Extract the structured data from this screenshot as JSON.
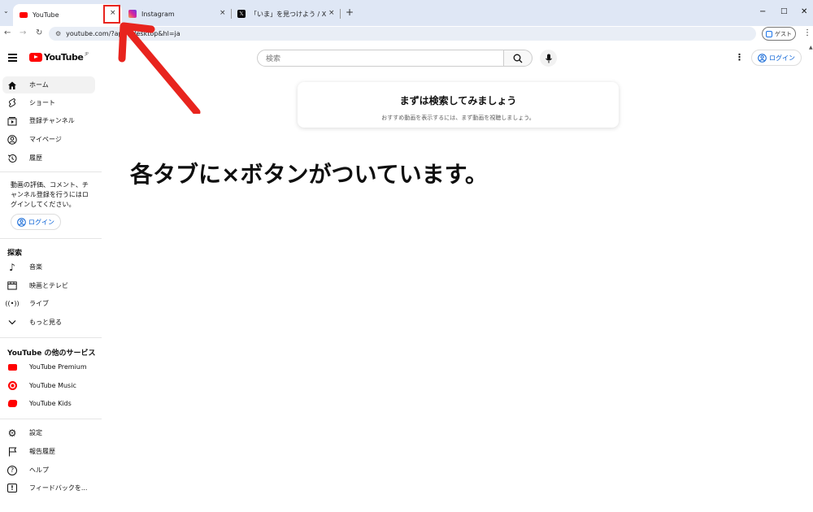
{
  "browser": {
    "tabs": [
      {
        "title": "YouTube"
      },
      {
        "title": "Instagram"
      },
      {
        "title": "「いま」を見つけよう / X"
      }
    ],
    "tab_close_glyph": "×",
    "new_tab_glyph": "+",
    "url": "youtube.com/?app=desktop&hl=ja",
    "guest_label": "ゲスト",
    "window_controls": {
      "minimize": "−",
      "maximize": "□",
      "close": "✕"
    }
  },
  "header": {
    "logo_text": "YouTube",
    "logo_region": "JP",
    "search_placeholder": "検索",
    "signin_label": "ログイン"
  },
  "sidebar": {
    "primary": [
      {
        "label": "ホーム",
        "icon": "home-icon"
      },
      {
        "label": "ショート",
        "icon": "shorts-icon"
      },
      {
        "label": "登録チャンネル",
        "icon": "subscriptions-icon"
      },
      {
        "label": "マイページ",
        "icon": "account-icon"
      },
      {
        "label": "履歴",
        "icon": "history-icon"
      }
    ],
    "signin_prompt": "動画の評価、コメント、チャンネル登録を行うにはログインしてください。",
    "signin_label": "ログイン",
    "explore_heading": "探索",
    "explore": [
      {
        "label": "音楽",
        "icon": "music-icon"
      },
      {
        "label": "映画とテレビ",
        "icon": "movies-icon"
      },
      {
        "label": "ライブ",
        "icon": "live-icon"
      },
      {
        "label": "もっと見る",
        "icon": "chevron-down-icon"
      }
    ],
    "services_heading": "YouTube の他のサービス",
    "services": [
      {
        "label": "YouTube Premium",
        "icon": "youtube-premium-icon"
      },
      {
        "label": "YouTube Music",
        "icon": "youtube-music-icon"
      },
      {
        "label": "YouTube Kids",
        "icon": "youtube-kids-icon"
      }
    ],
    "settings": [
      {
        "label": "設定",
        "icon": "settings-icon"
      },
      {
        "label": "報告履歴",
        "icon": "flag-icon"
      },
      {
        "label": "ヘルプ",
        "icon": "help-icon"
      },
      {
        "label": "フィードバックを...",
        "icon": "feedback-icon"
      }
    ]
  },
  "main": {
    "cta_title": "まずは検索してみましょう",
    "cta_sub": "おすすめ動画を表示するには、まず動画を視聴しましょう。"
  },
  "annotation": {
    "text": "各タブに×ボタンがついています。",
    "color": "#e8241e"
  }
}
